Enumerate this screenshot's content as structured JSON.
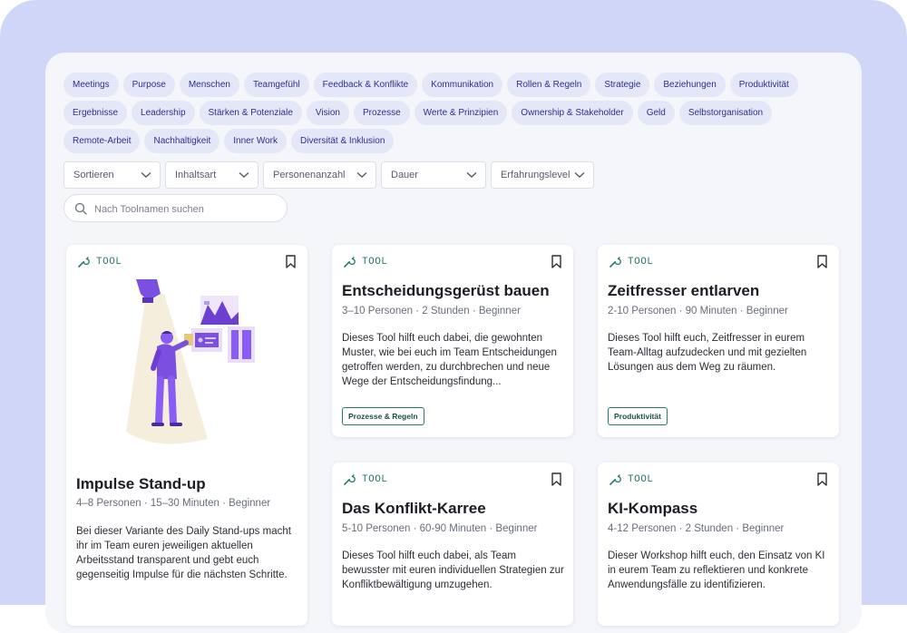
{
  "categories": {
    "row1": [
      "Meetings",
      "Purpose",
      "Menschen",
      "Teamgefühl",
      "Feedback & Konflikte",
      "Kommunikation",
      "Rollen & Regeln",
      "Strategie",
      "Beziehungen",
      "Produktivität"
    ],
    "row2": [
      "Ergebnisse",
      "Leadership",
      "Stärken & Potenziale",
      "Vision",
      "Prozesse",
      "Werte & Prinzipien",
      "Ownership & Stakeholder",
      "Geld",
      "Selbstorganisation"
    ],
    "row3": [
      "Remote-Arbeit",
      "Nachhaltigkeit",
      "Inner Work",
      "Diversität & Inklusion"
    ]
  },
  "filters": {
    "sort": "Sortieren",
    "content_type": "Inhaltsart",
    "people": "Personenanzahl",
    "duration": "Dauer",
    "experience": "Erfahrungslevel"
  },
  "search": {
    "placeholder": "Nach Toolnamen suchen",
    "value": ""
  },
  "cards": [
    {
      "type": "TOOL",
      "title": "Impulse Stand-up",
      "meta": "4–8 Personen · 15–30 Minuten · Beginner",
      "description": "Bei dieser Variante des Daily Stand-ups macht ihr im Team euren jeweiligen aktuellen Arbeitsstand transparent und gebt euch gegenseitig Impulse für die nächsten Schritte.",
      "illustration": "person-spotlight-presentation-illustration"
    },
    {
      "type": "TOOL",
      "title": "Entscheidungsgerüst bauen",
      "meta": "3–10 Personen · 2 Stunden · Beginner",
      "description": "Dieses Tool hilft euch dabei, die gewohnten Muster, wie bei euch im Team Entscheidungen getroffen werden, zu durchbrechen und neue Wege der Entscheidungsfindung...",
      "tag": "Prozesse & Regeln"
    },
    {
      "type": "TOOL",
      "title": "Zeitfresser entlarven",
      "meta": "2-10 Personen · 90 Minuten · Beginner",
      "description": "Dieses Tool hilft euch, Zeitfresser in eurem Team-Alltag aufzudecken und mit gezielten Lösungen aus dem Weg zu räumen.",
      "tag": "Produktivität"
    },
    {
      "type": "TOOL",
      "title": "Das Konflikt-Karree",
      "meta": "5-10 Personen · 60-90 Minuten · Beginner",
      "description": "Dieses Tool hilft euch dabei, als Team bewusster mit euren individuellen Strategien zur Konfliktbewältigung umzugehen."
    },
    {
      "type": "TOOL",
      "title": "KI-Kompass",
      "meta": "4-12 Personen · 2 Stunden · Beginner",
      "description": "Dieser Workshop hilft euch, den Einsatz von KI in eurem Team zu reflektieren und konkrete Anwendungsfälle zu identifizieren."
    }
  ],
  "icons": {
    "tool": "wrench-icon",
    "bookmark": "bookmark-icon",
    "search": "search-icon",
    "dropdown": "chevron-down-icon"
  },
  "colors": {
    "background": "#cfd6f7",
    "panel": "#f5f6fa",
    "chip": "#e4e7f8",
    "chip_text": "#2f2f8a",
    "tool_label": "#247a6e",
    "illustration_purple": "#8a5cf6"
  }
}
